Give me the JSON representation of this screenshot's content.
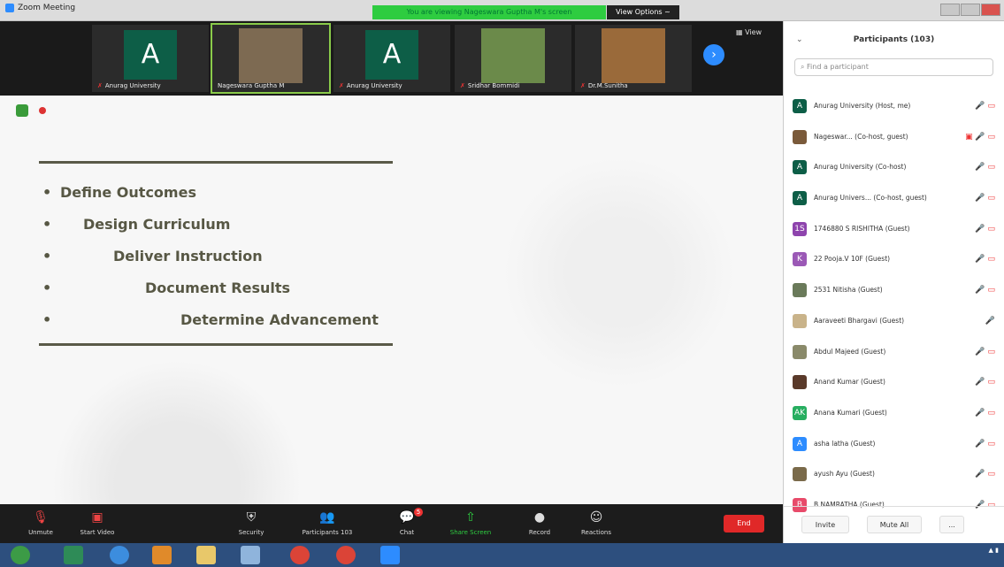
{
  "titlebar": {
    "app_name": "Zoom Meeting",
    "viewing_banner": "You are viewing Nageswara Guptha M's screen",
    "view_options": "View Options ~"
  },
  "colors": {
    "accent": "#2d8cff",
    "danger": "#e02828",
    "active_green": "#2ecc40",
    "avatar_green": "#0d5e47"
  },
  "gallery": {
    "tiles": [
      {
        "caption": "Anurag University",
        "kind": "avatar",
        "letter": "A"
      },
      {
        "caption": "Nageswara Guptha M",
        "kind": "photo"
      },
      {
        "caption": "Anurag University",
        "kind": "avatar",
        "letter": "A"
      },
      {
        "caption": "Sridhar Bommidi",
        "kind": "photo"
      },
      {
        "caption": "Dr.M.Sunitha",
        "kind": "photo"
      }
    ],
    "view_label": "View"
  },
  "slide": {
    "bullets": [
      {
        "text": "Define Outcomes"
      },
      {
        "text": "Design Curriculum"
      },
      {
        "text": "Deliver Instruction"
      },
      {
        "text": "Document Results"
      },
      {
        "text": "Determine Advancement"
      }
    ]
  },
  "toolbar": {
    "unmute": "Unmute",
    "start_video": "Start Video",
    "security": "Security",
    "participants": "Participants",
    "participants_count": "103",
    "chat": "Chat",
    "chat_badge": "5",
    "share_screen": "Share Screen",
    "record": "Record",
    "reactions": "Reactions",
    "end": "End"
  },
  "participants_panel": {
    "title": "Participants (103)",
    "search_placeholder": "Find a participant",
    "invite": "Invite",
    "mute_all": "Mute All",
    "more": "...",
    "items": [
      {
        "name": "Anurag University (Host, me)",
        "initials": "A",
        "color": "#0d5e47",
        "icons": "🎤 ▭"
      },
      {
        "name": "Nageswar... (Co-host, guest)",
        "initials": "",
        "color": "#7a5a3a",
        "icons": "▣ 🎤 ▭"
      },
      {
        "name": "Anurag University (Co-host)",
        "initials": "A",
        "color": "#0d5e47",
        "icons": "🎤 ▭"
      },
      {
        "name": "Anurag Univers... (Co-host, guest)",
        "initials": "A",
        "color": "#0d5e47",
        "icons": "🎤 ▭"
      },
      {
        "name": "1746880 S RISHITHA (Guest)",
        "initials": "1S",
        "color": "#8e44ad",
        "icons": "🎤 ▭"
      },
      {
        "name": "22 Pooja.V 10F (Guest)",
        "initials": "K",
        "color": "#9b59b6",
        "icons": "🎤 ▭"
      },
      {
        "name": "2531 Nitisha (Guest)",
        "initials": "",
        "color": "#6a7a5a",
        "icons": "🎤 ▭"
      },
      {
        "name": "Aaraveeti Bhargavi (Guest)",
        "initials": "",
        "color": "#c9b38a",
        "icons": "🎤"
      },
      {
        "name": "Abdul Majeed (Guest)",
        "initials": "",
        "color": "#8a8a6a",
        "icons": "🎤 ▭"
      },
      {
        "name": "Anand Kumar (Guest)",
        "initials": "",
        "color": "#5a3a2a",
        "icons": "🎤 ▭"
      },
      {
        "name": "Anana Kumari (Guest)",
        "initials": "AK",
        "color": "#27ae60",
        "icons": "🎤 ▭"
      },
      {
        "name": "asha latha (Guest)",
        "initials": "A",
        "color": "#2d8cff",
        "icons": "🎤 ▭"
      },
      {
        "name": "ayush Ayu (Guest)",
        "initials": "",
        "color": "#7a6a4a",
        "icons": "🎤 ▭"
      },
      {
        "name": "B NAMRATHA (Guest)",
        "initials": "B",
        "color": "#e84a6a",
        "icons": "🎤 ▭"
      }
    ]
  }
}
